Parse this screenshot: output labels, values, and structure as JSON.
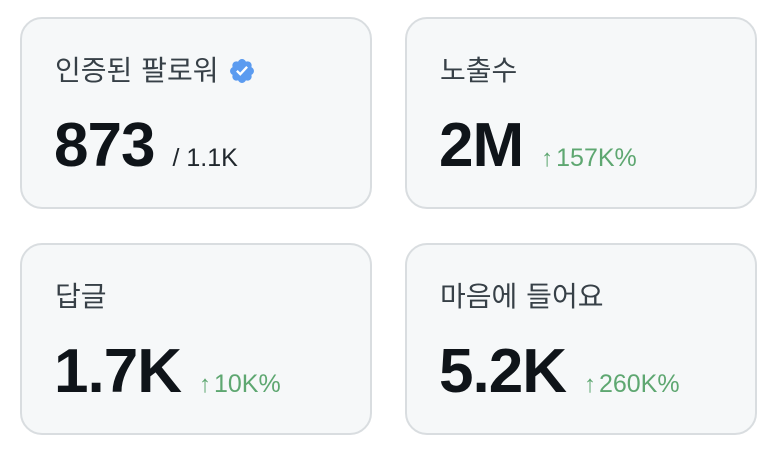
{
  "cards": [
    {
      "label": "인증된 팔로워",
      "icon": "verified-badge-icon",
      "icon_color": "#5b9bf0",
      "value": "873",
      "sub": "/ 1.1K"
    },
    {
      "label": "노출수",
      "value": "2M",
      "change_arrow": "↑",
      "change": "157K%"
    },
    {
      "label": "답글",
      "value": "1.7K",
      "change_arrow": "↑",
      "change": "10K%"
    },
    {
      "label": "마음에 들어요",
      "value": "5.2K",
      "change_arrow": "↑",
      "change": "260K%"
    }
  ],
  "colors": {
    "card_bg": "#f6f8f9",
    "card_border": "#d9dde0",
    "positive": "#5ea771",
    "value_text": "#0f1419"
  }
}
